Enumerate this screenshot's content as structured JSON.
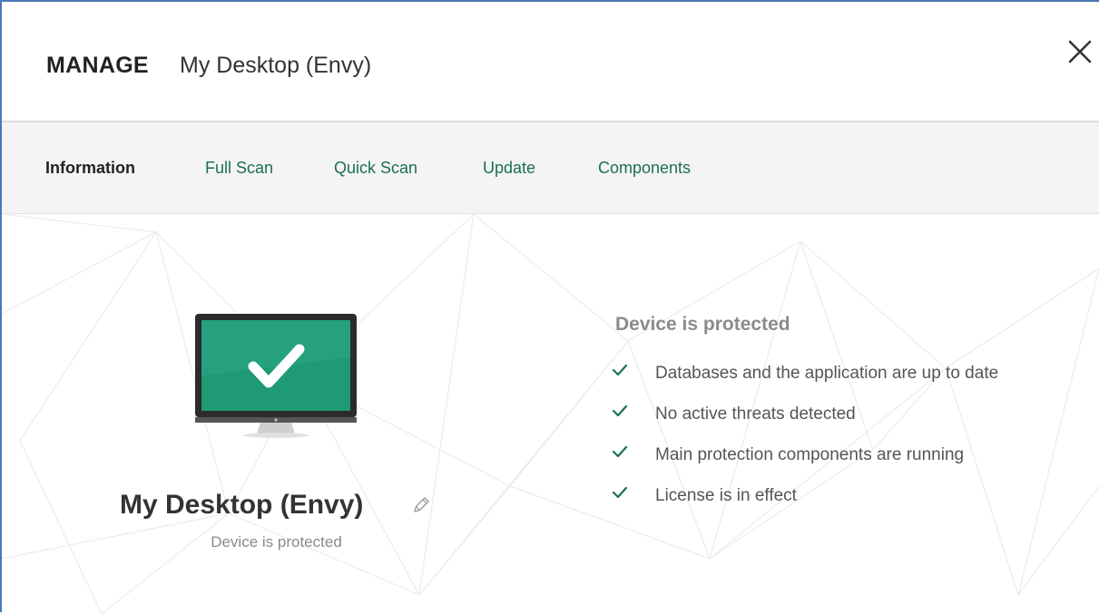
{
  "header": {
    "title_strong": "MANAGE",
    "title_device": "My Desktop (Envy)",
    "close_icon": "close-icon"
  },
  "tabs": [
    {
      "label": "Information",
      "active": true
    },
    {
      "label": "Full Scan",
      "active": false
    },
    {
      "label": "Quick Scan",
      "active": false
    },
    {
      "label": "Update",
      "active": false
    },
    {
      "label": "Components",
      "active": false
    }
  ],
  "device": {
    "name": "My Desktop (Envy)",
    "status": "Device is protected",
    "icon": "monitor-check-icon",
    "edit_icon": "pencil-icon"
  },
  "status_panel": {
    "title": "Device is protected",
    "items": [
      "Databases and the application are up to date",
      "No active threats detected",
      "Main protection components are running",
      "License is in effect"
    ]
  },
  "colors": {
    "accent_green": "#1b6e56",
    "screen_green": "#1f9a77",
    "frame_blue": "#4a78b5"
  }
}
